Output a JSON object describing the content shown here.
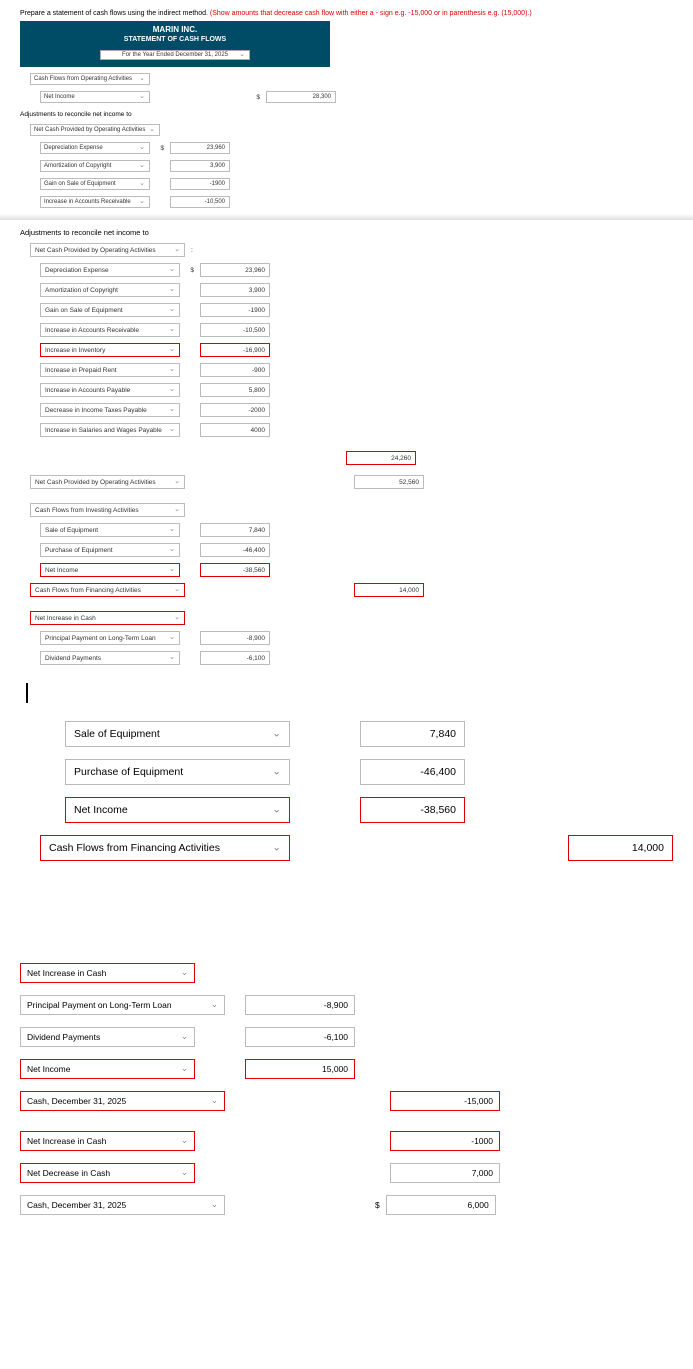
{
  "instruction_plain": "Prepare a statement of cash flows using the indirect method. ",
  "instruction_red": "(Show amounts that decrease cash flow with either a - sign e.g. -15,000 or in parenthesis e.g. (15,000).)",
  "header": {
    "company": "MARIN INC.",
    "title": "STATEMENT OF CASH FLOWS",
    "date": "For the Year Ended December 31, 2025"
  },
  "sect1": {
    "r1": "Cash Flows from Operating Activities",
    "r2": "Net Income",
    "r2_val": "28,300",
    "adj_label": "Adjustments to reconcile net income to",
    "r3": "Net Cash Provided by Operating Activities",
    "r4": "Depreciation Expense",
    "r4_val": "23,960",
    "r5": "Amortization of Copyright",
    "r5_val": "3,900",
    "r6": "Gain on Sale of Equipment",
    "r6_val": "-1900",
    "r7": "Increase in Accounts Receivable",
    "r7_val": "-10,500"
  },
  "sect2": {
    "adj_label": "Adjustments to reconcile net income to",
    "r1": "Net Cash Provided by Operating Activities",
    "r1_suffix": ":",
    "r2": "Depreciation Expense",
    "r2_val": "23,960",
    "r3": "Amortization of Copyright",
    "r3_val": "3,900",
    "r4": "Gain on Sale of Equipment",
    "r4_val": "-1900",
    "r5": "Increase in Accounts Receivable",
    "r5_val": "-10,500",
    "r6": "Increase in Inventory",
    "r6_val": "-16,900",
    "r7": "Increase in Prepaid Rent",
    "r7_val": "-900",
    "r8": "Increase in Accounts Payable",
    "r8_val": "5,800",
    "r9": "Decrease in Income Taxes Payable",
    "r9_val": "-2000",
    "r10": "Increase in Salaries and Wages Payable",
    "r10_val": "4000",
    "sub1": "24,260",
    "r11": "Net Cash Provided by Operating Activities",
    "r11_val": "52,560",
    "r12": "Cash Flows from Investing Activities",
    "r13": "Sale of Equipment",
    "r13_val": "7,840",
    "r14": "Purchase of Equipment",
    "r14_val": "-46,400",
    "r15": "Net Income",
    "r15_val": "-38,560",
    "r16": "Cash Flows from Financing Activities",
    "r16_val": "14,000",
    "r17": "Net Increase in Cash",
    "r18": "Principal Payment on Long-Term Loan",
    "r18_val": "-8,900",
    "r19": "Dividend Payments",
    "r19_val": "-6,100"
  },
  "zoom1": {
    "r1": "Sale of Equipment",
    "r1_val": "7,840",
    "r2": "Purchase of Equipment",
    "r2_val": "-46,400",
    "r3": "Net Income",
    "r3_val": "-38,560",
    "r4": "Cash Flows from Financing Activities",
    "r4_val": "14,000"
  },
  "zoom2": {
    "r1": "Net Increase in Cash",
    "r2": "Principal Payment on Long-Term Loan",
    "r2_val": "-8,900",
    "r3": "Dividend Payments",
    "r3_val": "-6,100",
    "r4": "Net Income",
    "r4_val": "15,000",
    "r5": "Cash, December 31, 2025",
    "r5_val": "-15,000",
    "r6": "Net Increase in Cash",
    "r6_val": "-1000",
    "r7": "Net Decrease in Cash",
    "r7_val": "7,000",
    "r8": "Cash, December 31, 2025",
    "r8_val": "6,000",
    "dollar": "$"
  }
}
